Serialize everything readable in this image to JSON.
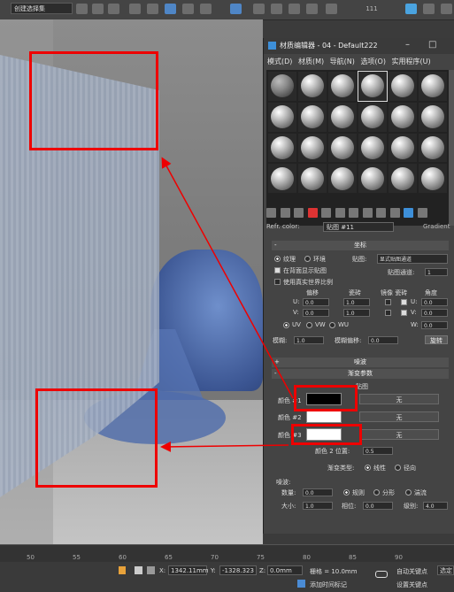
{
  "toolbar": {
    "selection_set": "创建选择集",
    "number": "111"
  },
  "material_editor": {
    "title": "材质编辑器 - 04 - Default222",
    "minimize": "–",
    "maximize": "□",
    "menu": [
      "模式(D)",
      "材质(M)",
      "导航(N)",
      "选项(O)",
      "实用程序(U)"
    ],
    "refr_label": "Refr. color:",
    "map_name": "贴图 #11",
    "map_type": "Gradient"
  },
  "coordinates": {
    "title": "坐标",
    "texture_label": "纹理",
    "environ_label": "环境",
    "map_label": "贴图:",
    "map_channel_dropdown": "显式贴图通道",
    "show_on_back": "在背面显示贴图",
    "map_channel_label": "贴图通道:",
    "map_channel_value": "1",
    "real_world": "使用真实世界比例",
    "offset_label": "偏移",
    "tiling_label": "瓷砖",
    "mirror_tile_label": "镜像 瓷砖",
    "angle_label": "角度",
    "u_label": "U:",
    "v_label": "V:",
    "w_label": "W:",
    "u_offset": "0.0",
    "u_tiling": "1.0",
    "v_offset": "0.0",
    "v_tiling": "1.0",
    "u_angle": "0.0",
    "v_angle": "0.0",
    "w_angle": "0.0",
    "uv": "UV",
    "vw": "VW",
    "wu": "WU",
    "blur_label": "模糊:",
    "blur_value": "1.0",
    "blur_offset_label": "模糊偏移:",
    "blur_offset_value": "0.0",
    "rotate_btn": "旋转"
  },
  "noise_rollout": {
    "title": "噪波"
  },
  "gradient_params": {
    "title": "渐变参数",
    "map_header": "贴图",
    "color1_label": "颜色 #1",
    "color2_label": "颜色 #2",
    "color3_label": "颜色 #3",
    "none_label": "无",
    "color2_pos_label": "颜色 2 位置:",
    "color2_pos_value": "0.5",
    "grad_type_label": "渐变类型:",
    "linear": "线性",
    "radial": "径向",
    "noise_label": "噪波:",
    "amount_label": "数量:",
    "amount_value": "0.0",
    "regular": "规则",
    "fractal": "分形",
    "turbulence": "湍流",
    "size_label": "大小:",
    "size_value": "1.0",
    "phase_label": "相位:",
    "phase_value": "0.0",
    "levels_label": "级别:",
    "levels_value": "4.0",
    "color1": "#000000",
    "color2": "#ffffff",
    "color3": "#ffffff"
  },
  "timeline": {
    "ticks": [
      "50",
      "55",
      "60",
      "65",
      "70",
      "75",
      "80",
      "85",
      "90"
    ]
  },
  "statusbar": {
    "x_label": "X:",
    "x_value": "1342.11mm",
    "y_label": "Y:",
    "y_value": "-1328.323",
    "z_label": "Z:",
    "z_value": "0.0mm",
    "grid": "栅格 = 10.0mm",
    "add_time_tag": "添加时间标记",
    "auto_key": "自动关键点",
    "selected": "选定",
    "set_key": "设置关键点"
  },
  "highlight_color": "#e00000"
}
